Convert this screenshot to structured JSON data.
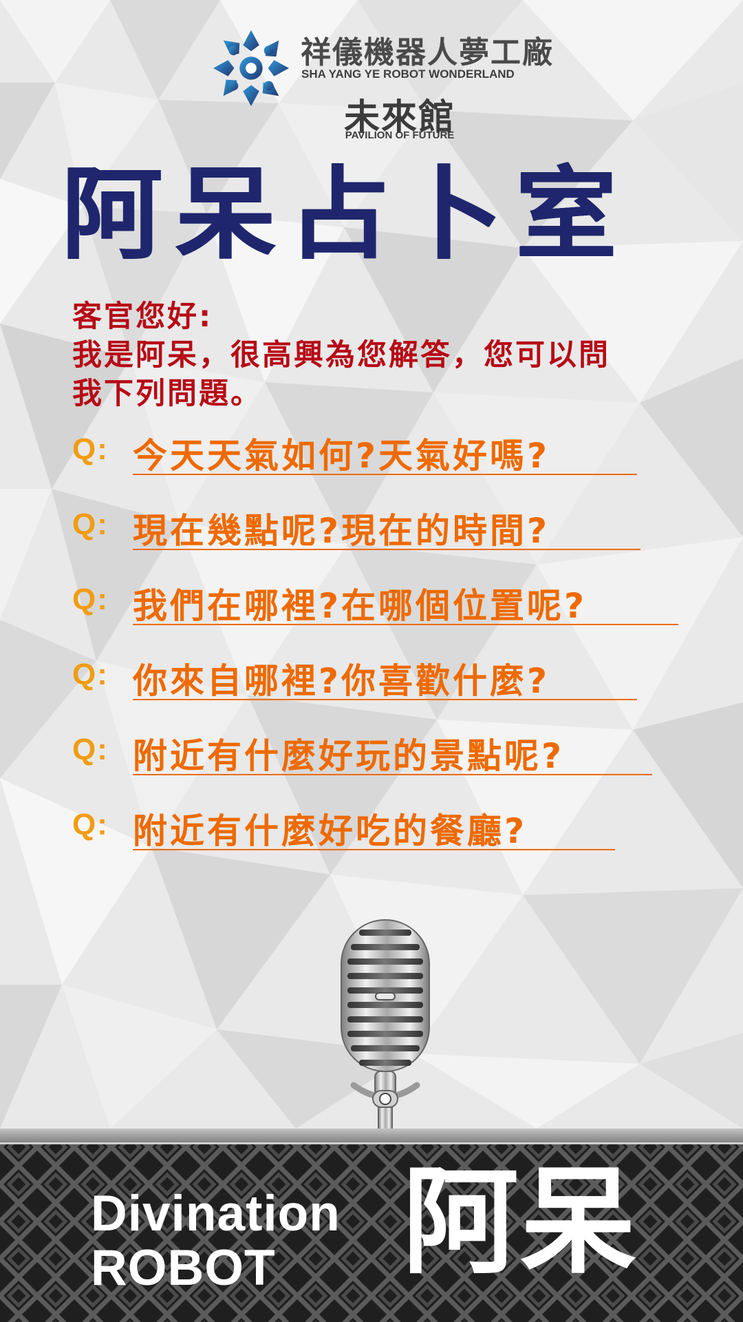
{
  "header": {
    "brand_zh": "祥儀機器人夢工廠",
    "brand_en": "SHA YANG YE ROBOT WONDERLAND",
    "pavilion_zh": "未來館",
    "pavilion_en": "PAVILION OF FUTURE",
    "logo_icon": "snowflake-gear-icon"
  },
  "title": "阿呆占卜室",
  "greeting": {
    "line1": "客官您好:",
    "line2": "我是阿呆，很高興為您解答，您可以問",
    "line3": "我下列問題。"
  },
  "questions": [
    {
      "marker": "Q:",
      "text": "今天天氣如何?天氣好嗎?"
    },
    {
      "marker": "Q:",
      "text": "現在幾點呢?現在的時間?"
    },
    {
      "marker": "Q:",
      "text": "我們在哪裡?在哪個位置呢?"
    },
    {
      "marker": "Q:",
      "text": "你來自哪裡?你喜歡什麼?"
    },
    {
      "marker": "Q:",
      "text": "附近有什麼好玩的景點呢?"
    },
    {
      "marker": "Q:",
      "text": "附近有什麼好吃的餐廳?"
    }
  ],
  "microphone_icon": "microphone-icon",
  "bottom": {
    "en_line1": "Divination",
    "en_line2": "ROBOT",
    "zh": "阿呆"
  },
  "colors": {
    "title": "#1f266d",
    "greeting": "#b70b16",
    "question_marker": "#f19c13",
    "question_text": "#ee6a00",
    "bottom_text": "#ffffff"
  }
}
